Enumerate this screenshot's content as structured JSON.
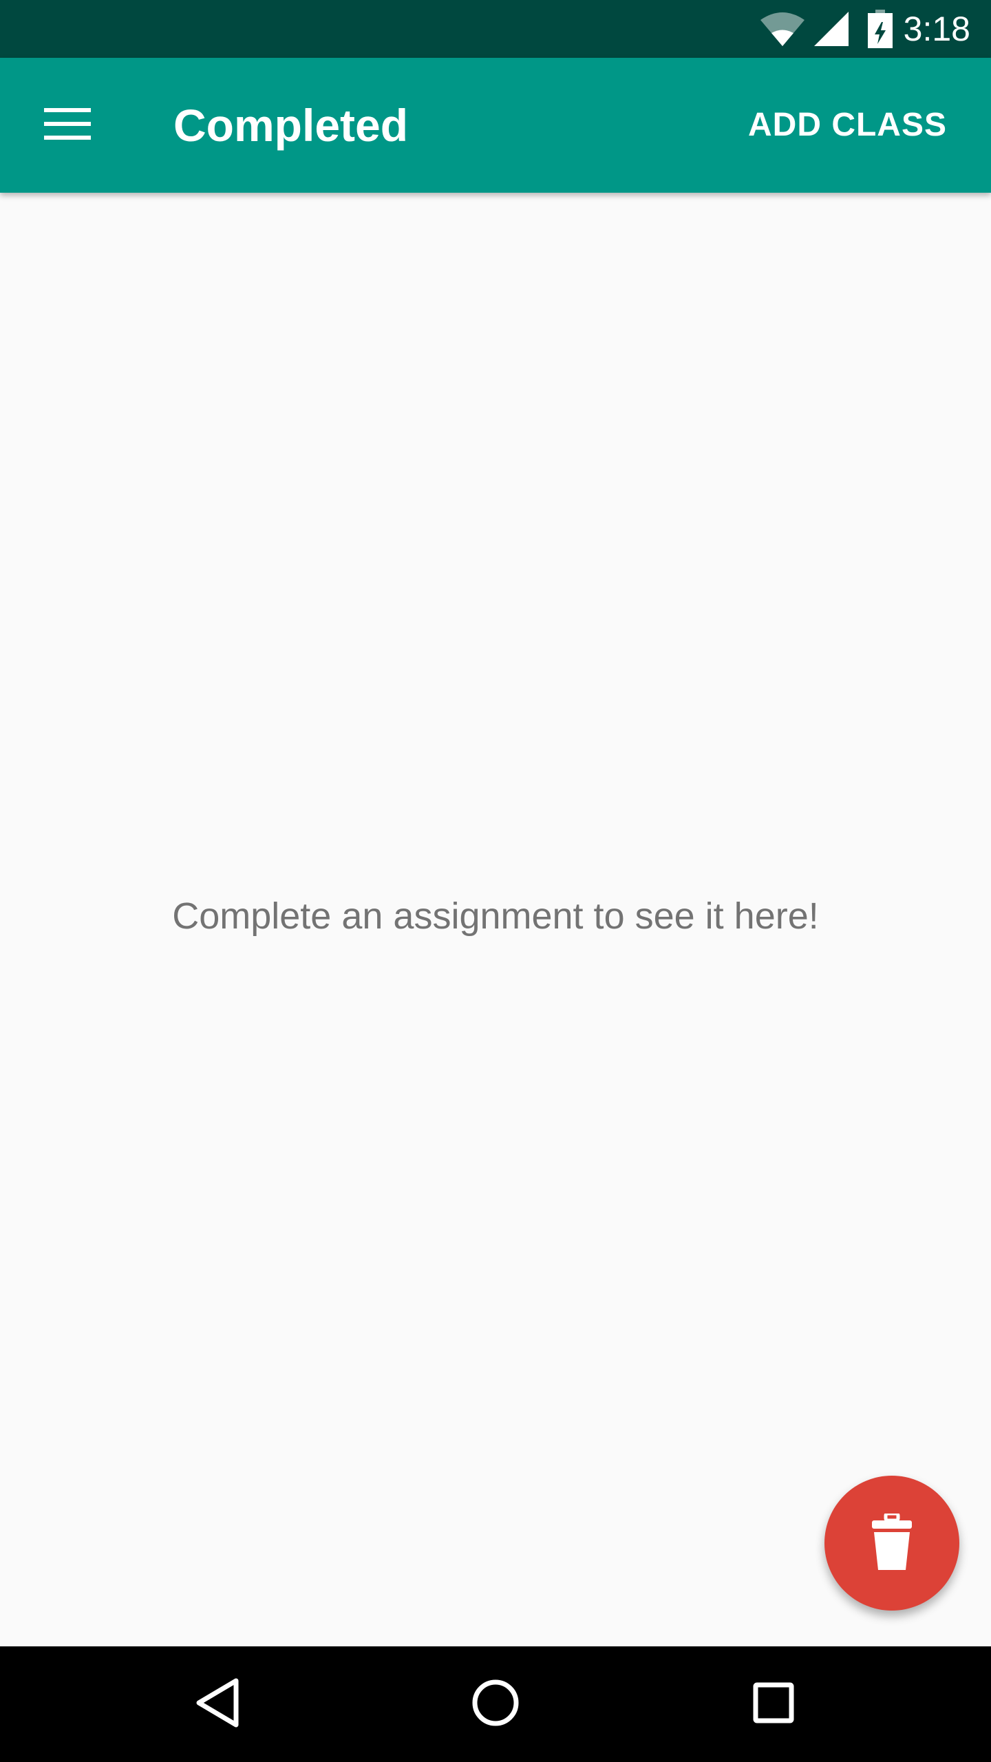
{
  "status_bar": {
    "time": "3:18",
    "icons": [
      "wifi-icon",
      "signal-icon",
      "battery-charging-icon"
    ]
  },
  "app_bar": {
    "menu_icon": "menu-icon",
    "title": "Completed",
    "action_label": "ADD CLASS",
    "background_color": "#009787",
    "status_bar_color": "#00483f"
  },
  "main": {
    "empty_message": "Complete an assignment to see it here!",
    "background_color": "#fafafa"
  },
  "fab": {
    "icon": "trash-icon",
    "color": "#dc4237"
  },
  "nav_bar": {
    "buttons": [
      "back-icon",
      "home-icon",
      "recents-icon"
    ]
  }
}
